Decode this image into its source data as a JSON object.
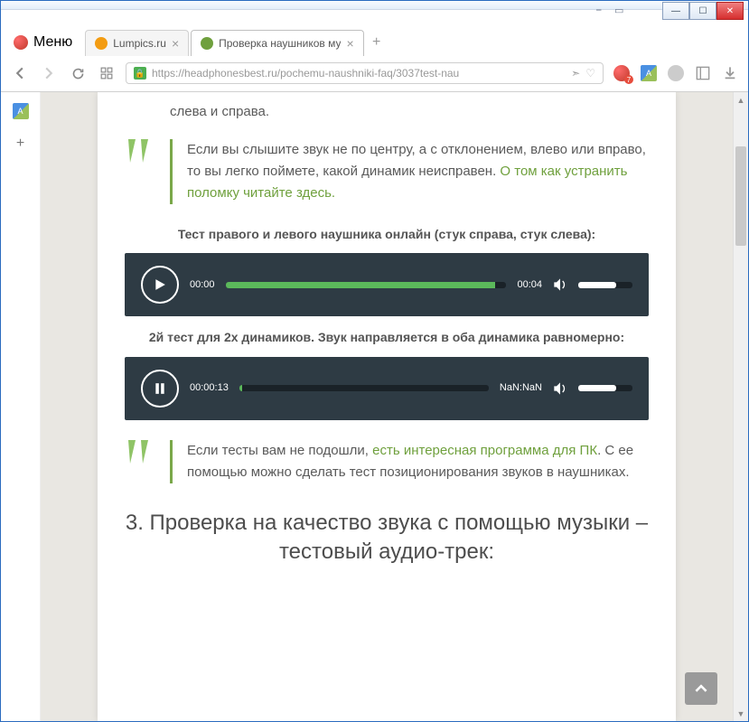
{
  "window": {
    "menu_label": "Меню"
  },
  "tabs": [
    {
      "title": "Lumpics.ru",
      "favicon_color": "#f39c12"
    },
    {
      "title": "Проверка наушников му",
      "favicon_color": "#6fa03d"
    }
  ],
  "address": {
    "url_display": "https://headphonesbest.ru/pochemu-naushniki-faq/3037test-nau",
    "opera_badge": "7"
  },
  "article": {
    "intro_fragment": "слева и справа.",
    "quote1_text": "Если вы слышите звук не по центру, а с отклонением, влево или вправо, то вы легко поймете, какой динамик неисправен. ",
    "quote1_link": "О том как устранить поломку читайте здесь.",
    "caption1": "Тест правого и левого наушника онлайн (стук справа, стук слева):",
    "caption2": "2й тест для 2х динамиков. Звук направляется в оба динамика равномерно:",
    "quote2_pre": "Если тесты вам не подошли, ",
    "quote2_link": "есть интересная программа для ПК",
    "quote2_post": ". С ее помощью можно сделать тест позиционирования звуков в наушниках.",
    "heading3": "3. Проверка на качество звука с помощью музыки – тестовый аудио-трек:"
  },
  "player1": {
    "current": "00:00",
    "duration": "00:04",
    "progress_pct": 96,
    "volume_pct": 70,
    "state": "paused"
  },
  "player2": {
    "current": "00:00:13",
    "duration": "NaN:NaN",
    "progress_pct": 1,
    "volume_pct": 70,
    "state": "playing"
  }
}
